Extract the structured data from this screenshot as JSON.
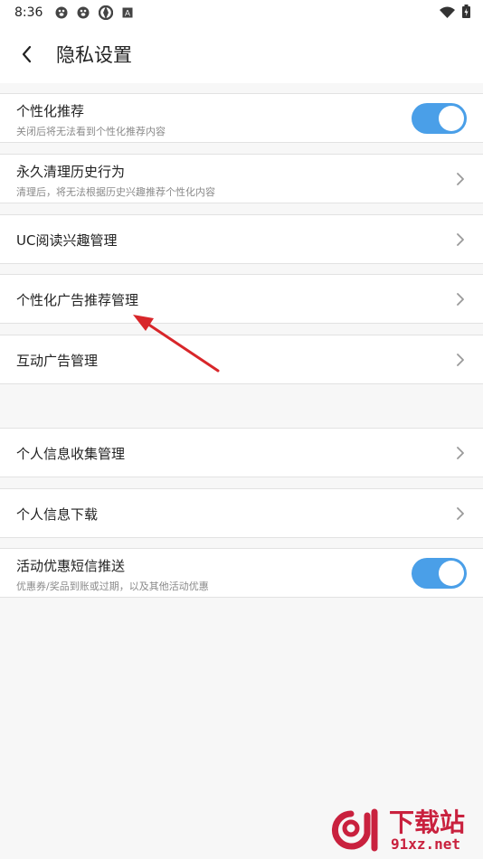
{
  "status_bar": {
    "time": "8:36",
    "left_icons": [
      "baidu-paw-icon",
      "baidu-paw-icon",
      "aperture-icon",
      "a-box-icon"
    ],
    "right_icons": [
      "wifi-icon",
      "battery-icon"
    ]
  },
  "header": {
    "back_icon": "chevron-left-icon",
    "title": "隐私设置"
  },
  "settings": [
    {
      "title": "个性化推荐",
      "subtitle": "关闭后将无法看到个性化推荐内容",
      "control": "toggle",
      "on": true
    },
    {
      "title": "永久清理历史行为",
      "subtitle": "清理后，将无法根据历史兴趣推荐个性化内容",
      "control": "chevron"
    },
    {
      "title": "UC阅读兴趣管理",
      "control": "chevron"
    },
    {
      "title": "个性化广告推荐管理",
      "control": "chevron"
    },
    {
      "title": "互动广告管理",
      "control": "chevron"
    },
    {
      "title": "个人信息收集管理",
      "control": "chevron"
    },
    {
      "title": "个人信息下载",
      "control": "chevron"
    },
    {
      "title": "活动优惠短信推送",
      "subtitle": "优惠券/奖品到账或过期，以及其他活动优惠",
      "control": "toggle",
      "on": true
    }
  ],
  "colors": {
    "toggle_on": "#4a9fe8",
    "annotation_arrow": "#d8262a",
    "watermark": "#c9213e"
  },
  "watermark": {
    "line1": "下载站",
    "line2": "91xz.net"
  }
}
